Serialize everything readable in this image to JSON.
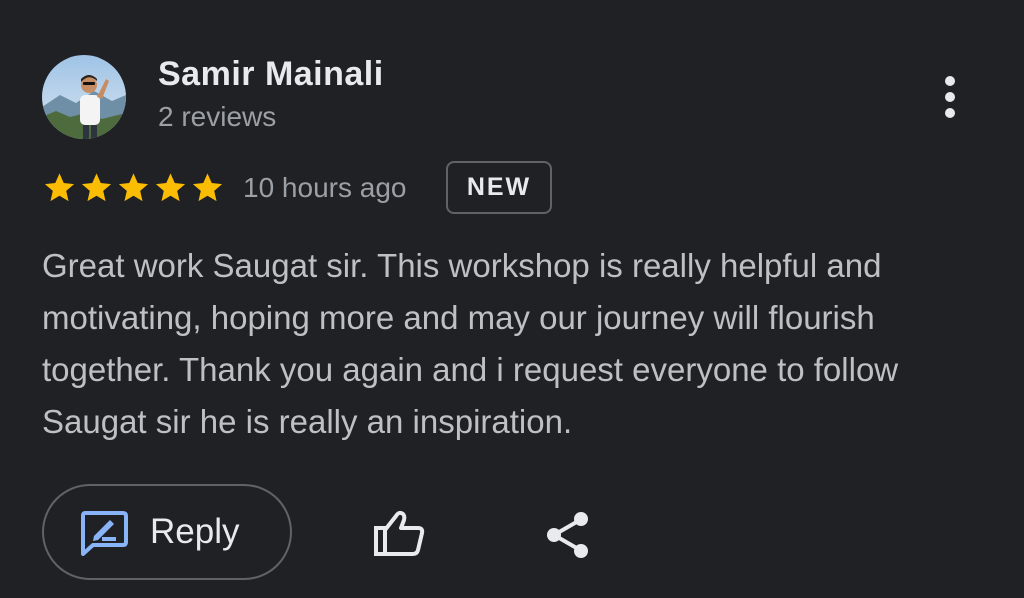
{
  "reviewer": {
    "name": "Samir Mainali",
    "review_count": "2 reviews",
    "avatar_icon": "avatar-photo"
  },
  "rating": {
    "stars": 5,
    "max_stars": 5,
    "star_color": "#fbbc04"
  },
  "timestamp": "10 hours ago",
  "badge": "NEW",
  "review_text": "Great work Saugat sir. This workshop is really helpful and motivating, hoping more and may our journey will flourish together. Thank you again and i request everyone to follow Saugat sir he is really an inspiration.",
  "actions": {
    "reply_label": "Reply",
    "reply_icon": "reply-edit-icon",
    "like_icon": "thumbs-up-icon",
    "share_icon": "share-icon",
    "more_icon": "more-vert-icon"
  },
  "colors": {
    "background": "#202124",
    "primary_text": "#e8eaed",
    "secondary_text": "#9aa0a6",
    "accent_blue": "#8ab4f8",
    "border": "#5f6368"
  }
}
